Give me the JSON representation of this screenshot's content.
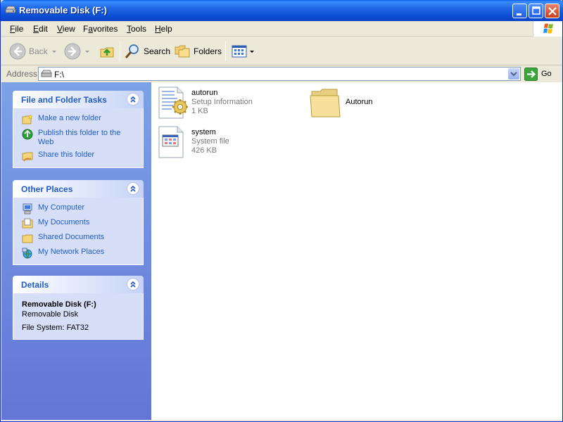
{
  "window": {
    "title": "Removable Disk (F:)"
  },
  "menu": [
    {
      "label": "File",
      "key": "F",
      "rest": "ile"
    },
    {
      "label": "Edit",
      "key": "E",
      "rest": "dit"
    },
    {
      "label": "View",
      "key": "V",
      "rest": "iew"
    },
    {
      "label": "Favorites",
      "key": "F",
      "rest": "avorites",
      "keypos": "a"
    },
    {
      "label": "Tools",
      "key": "T",
      "rest": "ools"
    },
    {
      "label": "Help",
      "key": "H",
      "rest": "elp"
    }
  ],
  "toolbar": {
    "back": "Back",
    "search": "Search",
    "folders": "Folders"
  },
  "address": {
    "label": "Address",
    "value": "F:\\",
    "go": "Go"
  },
  "tasks_panel": {
    "title": "File and Folder Tasks",
    "items": [
      "Make a new folder",
      "Publish this folder to the Web",
      "Share this folder"
    ]
  },
  "places_panel": {
    "title": "Other Places",
    "items": [
      "My Computer",
      "My Documents",
      "Shared Documents",
      "My Network Places"
    ]
  },
  "details_panel": {
    "title": "Details",
    "name": "Removable Disk (F:)",
    "type": "Removable Disk",
    "fs": "File System: FAT32"
  },
  "files": [
    {
      "name": "autorun",
      "type": "Setup Information",
      "size": "1 KB"
    },
    {
      "name": "Autorun"
    },
    {
      "name": "system",
      "type": "System file",
      "size": "426 KB"
    }
  ],
  "colors": {
    "title_bar": "#1f66e5",
    "panel_link": "#215dc6",
    "left_pane_top": "#7ba2e7",
    "left_pane_bottom": "#6375d6"
  }
}
